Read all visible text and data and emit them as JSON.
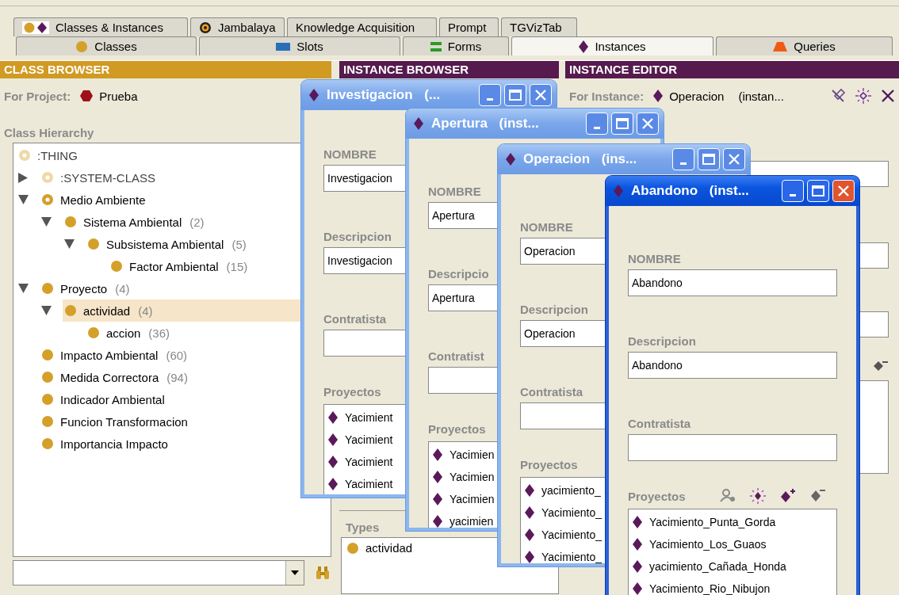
{
  "tab_rows": [
    {
      "tabs": [
        {
          "label": "Classes & Instances",
          "selected": false
        },
        {
          "label": "Jambalaya",
          "selected": false
        },
        {
          "label": "Knowledge Acquisition",
          "selected": false
        },
        {
          "label": "Prompt",
          "selected": false
        },
        {
          "label": "TGVizTab",
          "selected": false
        }
      ]
    },
    {
      "tabs": [
        {
          "label": "Classes",
          "selected": false
        },
        {
          "label": "Slots",
          "selected": false
        },
        {
          "label": "Forms",
          "selected": false
        },
        {
          "label": "Instances",
          "selected": true
        },
        {
          "label": "Queries",
          "selected": false
        }
      ]
    }
  ],
  "class_browser": {
    "title": "CLASS BROWSER",
    "project_label": "For Project:",
    "project": "Prueba",
    "hierarchy_label": "Class Hierarchy",
    "tree": [
      {
        "label": ":THING",
        "kind": "system",
        "selected": false,
        "children": [
          {
            "label": ":SYSTEM-CLASS",
            "kind": "system",
            "expanded": false,
            "selected": false
          },
          {
            "label": "Medio Ambiente",
            "kind": "abstract",
            "expanded": true,
            "selected": false,
            "children": [
              {
                "label": "Sistema Ambiental",
                "count": "(2)",
                "kind": "concrete",
                "expanded": true,
                "selected": false,
                "children": [
                  {
                    "label": "Subsistema Ambiental",
                    "count": "(5)",
                    "kind": "concrete",
                    "expanded": true,
                    "selected": false,
                    "children": [
                      {
                        "label": "Factor Ambiental",
                        "count": "(15)",
                        "kind": "concrete",
                        "selected": false
                      }
                    ]
                  }
                ]
              }
            ]
          },
          {
            "label": "Proyecto",
            "count": "(4)",
            "kind": "concrete",
            "expanded": true,
            "selected": false,
            "children": [
              {
                "label": "actividad",
                "count": "(4)",
                "kind": "concrete",
                "expanded": true,
                "selected": true,
                "children": [
                  {
                    "label": "accion",
                    "count": "(36)",
                    "kind": "concrete",
                    "selected": false
                  }
                ]
              }
            ]
          },
          {
            "label": "Impacto Ambiental",
            "count": "(60)",
            "kind": "concrete",
            "selected": false
          },
          {
            "label": "Medida Correctora",
            "count": "(94)",
            "kind": "concrete",
            "selected": false
          },
          {
            "label": "Indicador Ambiental",
            "kind": "concrete",
            "selected": false
          },
          {
            "label": "Funcion Transformacion",
            "kind": "concrete",
            "selected": false
          },
          {
            "label": "Importancia Impacto",
            "kind": "concrete",
            "selected": false
          }
        ]
      }
    ]
  },
  "instance_browser": {
    "title": "INSTANCE BROWSER",
    "types_label": "Types",
    "types": [
      "actividad"
    ]
  },
  "instance_editor": {
    "title": "INSTANCE EDITOR",
    "instance_label": "For Instance:",
    "instance": "Operacion",
    "instance_type": "(instan..."
  },
  "windows": [
    {
      "title": "Investigacion (...",
      "active": false,
      "fields": [
        {
          "label": "NOMBRE",
          "value": "Investigacion"
        },
        {
          "label": "Descripcion",
          "value": "Investigacion"
        },
        {
          "label": "Contratista"
        }
      ],
      "list_label": "Proyectos",
      "items": [
        "Yacimient",
        "Yacimient",
        "Yacimient",
        "Yacimient"
      ]
    },
    {
      "title": "Apertura (inst...",
      "active": false,
      "fields": [
        {
          "label": "NOMBRE",
          "value": "Apertura"
        },
        {
          "label": "Descripcio",
          "value": "Apertura"
        },
        {
          "label": "Contratist"
        }
      ],
      "list_label": "Proyectos",
      "items": [
        "Yacimien",
        "Yacimien",
        "Yacimien",
        "yacimien"
      ]
    },
    {
      "title": "Operacion (ins...",
      "active": false,
      "fields": [
        {
          "label": "NOMBRE",
          "value": "Operacion"
        },
        {
          "label": "Descripcion",
          "value": "Operacion"
        },
        {
          "label": "Contratista"
        }
      ],
      "list_label": "Proyectos",
      "items": [
        "yacimiento_",
        "Yacimiento_",
        "Yacimiento_",
        "Yacimiento_"
      ]
    },
    {
      "title": "Abandono (inst...",
      "active": true,
      "fields": [
        {
          "label": "NOMBRE",
          "value": "Abandono"
        },
        {
          "label": "Descripcion",
          "value": "Abandono"
        },
        {
          "label": "Contratista"
        }
      ],
      "list_label": "Proyectos",
      "items": [
        "Yacimiento_Punta_Gorda",
        "Yacimiento_Los_Guaos",
        "yacimiento_Cañada_Honda",
        "Yacimiento_Rio_Nibujon"
      ]
    }
  ]
}
